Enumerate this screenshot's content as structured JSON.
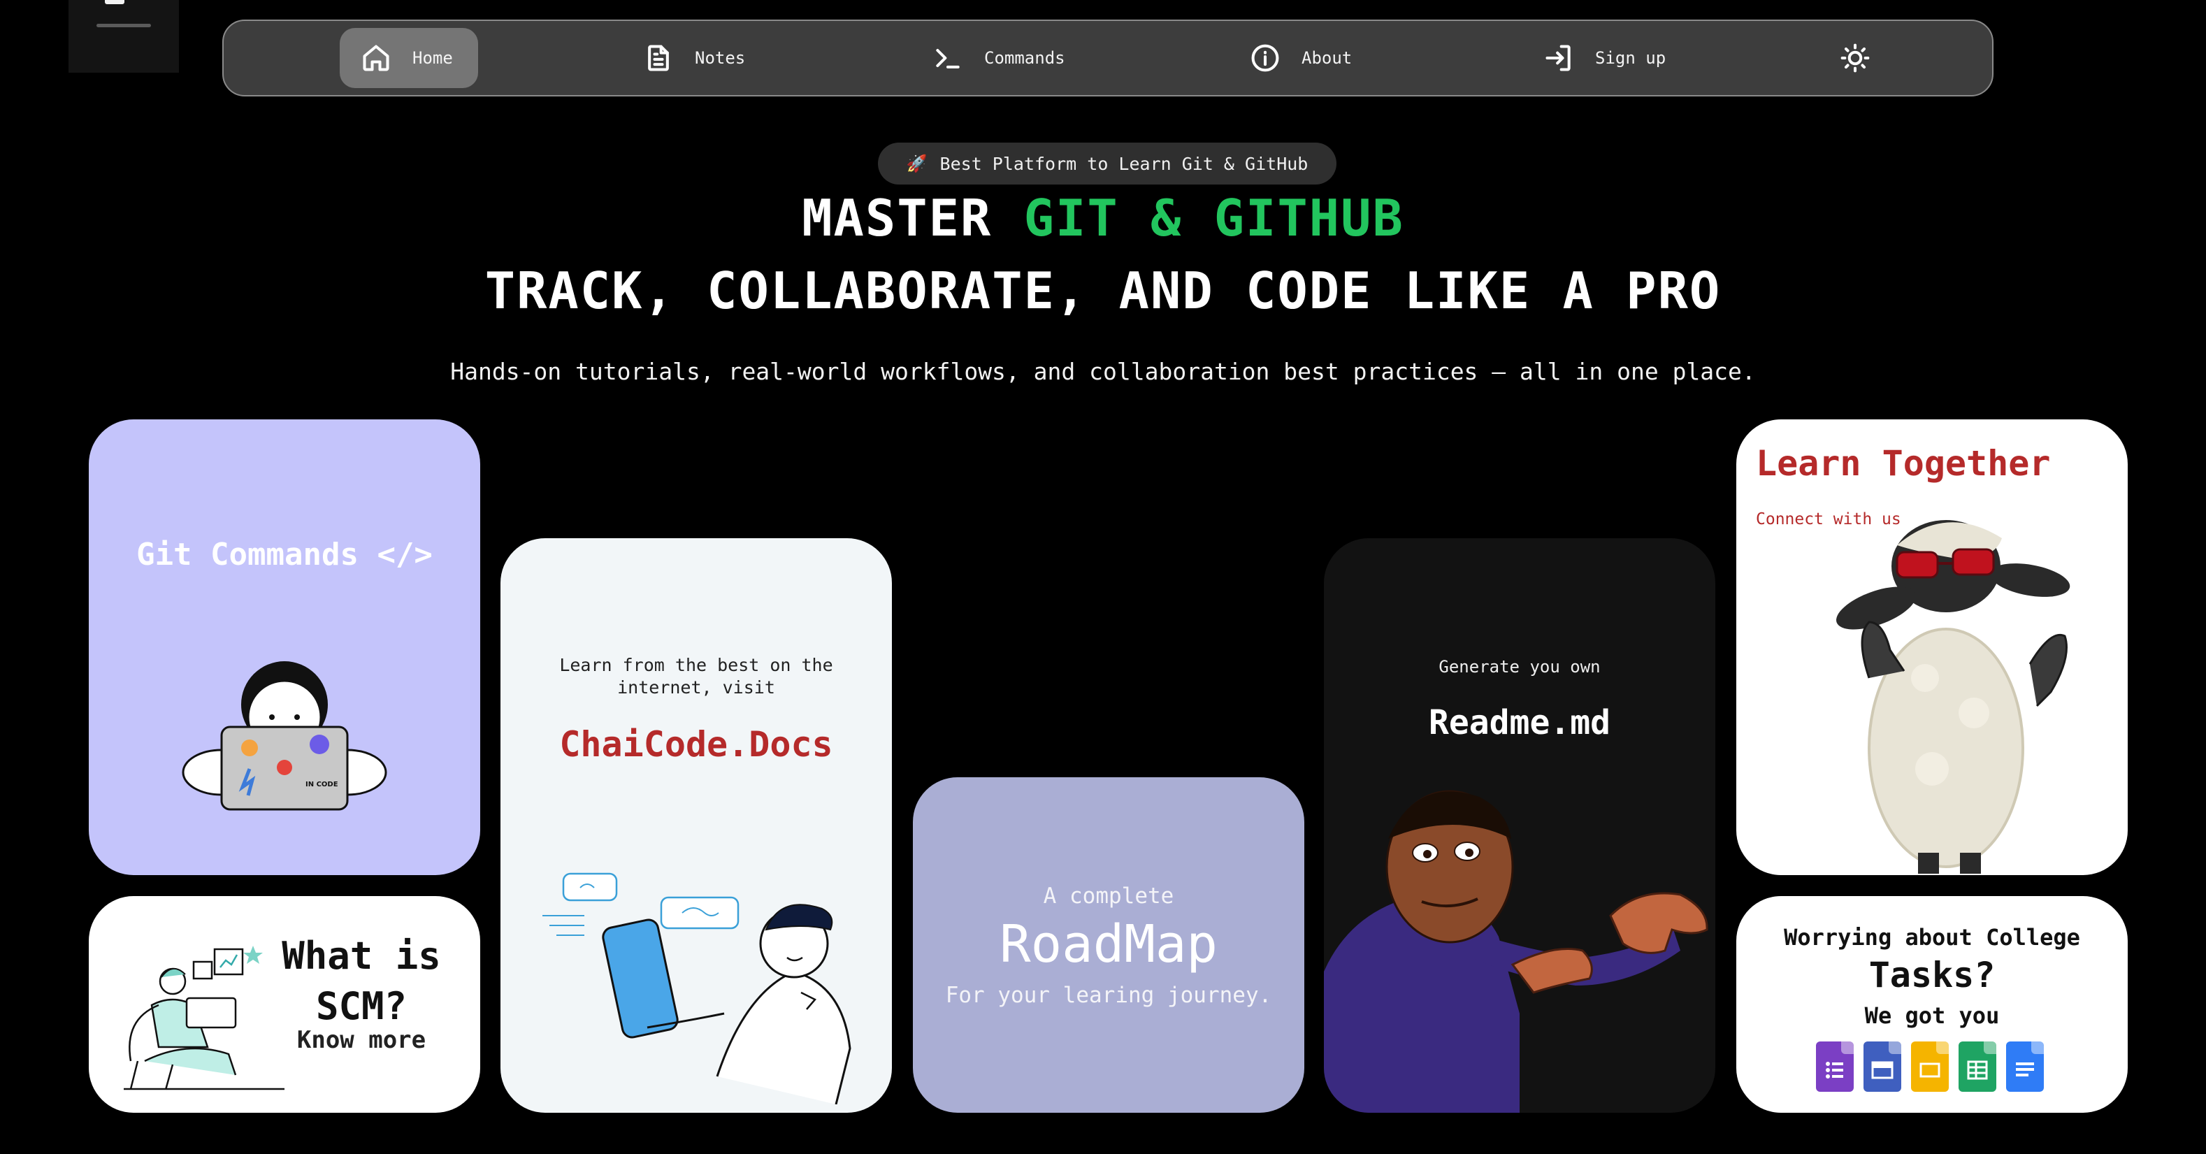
{
  "nav": {
    "items": [
      {
        "label": "Home",
        "icon": "home-icon",
        "active": true
      },
      {
        "label": "Notes",
        "icon": "document-icon"
      },
      {
        "label": "Commands",
        "icon": "terminal-icon"
      },
      {
        "label": "About",
        "icon": "info-icon"
      },
      {
        "label": "Sign up",
        "icon": "sign-in-icon"
      }
    ],
    "theme_icon": "sun-icon"
  },
  "hero": {
    "badge": "Best Platform to Learn Git & GitHub",
    "title_prefix": "MASTER ",
    "title_highlight": "GIT & GITHUB",
    "title_line2": "TRACK, COLLABORATE, AND CODE LIKE A PRO",
    "subtitle": "Hands-on tutorials, real-world workflows, and collaboration best practices – all in one place.",
    "accent_color": "#22c55e"
  },
  "cards": {
    "git_commands": {
      "title": "Git Commands </>",
      "bg": "#c4c4fb"
    },
    "scm": {
      "question_line1": "What is",
      "question_line2": "SCM?",
      "link": "Know more"
    },
    "docs": {
      "lead": "Learn from the best on the internet, visit",
      "brand": "ChaiCode.Docs",
      "brand_color": "#b52a2a"
    },
    "roadmap": {
      "line1": "A complete",
      "title": "RoadMap",
      "line3": "For your learing journey."
    },
    "readme": {
      "lead": "Generate you own",
      "title": "Readme.md"
    },
    "learn": {
      "title": "Learn Together",
      "subtitle": "Connect with us"
    },
    "college": {
      "line1": "Worrying about College",
      "line2": "Tasks?",
      "line3": "We got you",
      "apps": [
        {
          "name": "forms-icon",
          "color": "#7b3fc4"
        },
        {
          "name": "slides-blue-icon",
          "color": "#3f5fbf"
        },
        {
          "name": "slides-icon",
          "color": "#f5b400"
        },
        {
          "name": "sheets-icon",
          "color": "#1fa463"
        },
        {
          "name": "docs-icon",
          "color": "#2f7cf6"
        }
      ]
    }
  }
}
